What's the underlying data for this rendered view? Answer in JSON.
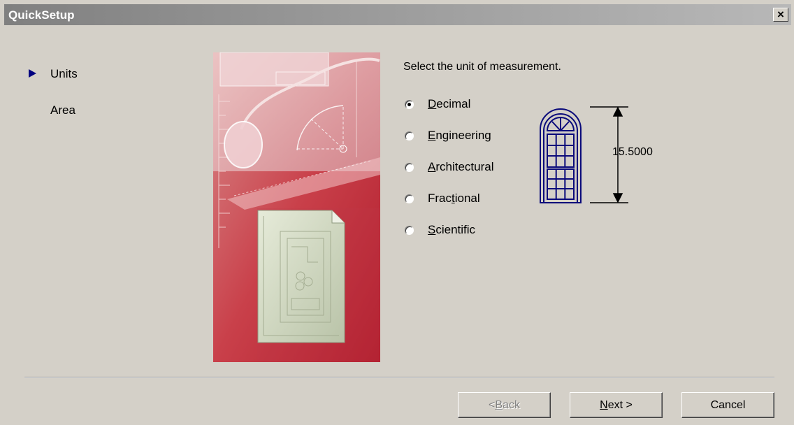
{
  "window": {
    "title": "QuickSetup",
    "close_glyph": "×"
  },
  "nav": {
    "items": [
      {
        "label": "Units",
        "active": true
      },
      {
        "label": "Area",
        "active": false
      }
    ]
  },
  "prompt": "Select the unit of measurement.",
  "units": {
    "selected": "Decimal",
    "options": [
      {
        "pre": "",
        "mnemonic": "D",
        "post": "ecimal"
      },
      {
        "pre": "",
        "mnemonic": "E",
        "post": "ngineering"
      },
      {
        "pre": "",
        "mnemonic": "A",
        "post": "rchitectural"
      },
      {
        "pre": "Frac",
        "mnemonic": "t",
        "post": "ional"
      },
      {
        "pre": "",
        "mnemonic": "S",
        "post": "cientific"
      }
    ]
  },
  "preview": {
    "dimension": "15.5000"
  },
  "buttons": {
    "back": {
      "pre": "< ",
      "mnemonic": "B",
      "post": "ack",
      "enabled": false
    },
    "next": {
      "pre": "",
      "mnemonic": "N",
      "post": "ext >",
      "enabled": true
    },
    "cancel": {
      "label": "Cancel",
      "enabled": true
    }
  },
  "colors": {
    "face": "#d4d0c8",
    "nav_arrow": "#000080",
    "title_text": "#ffffff"
  }
}
